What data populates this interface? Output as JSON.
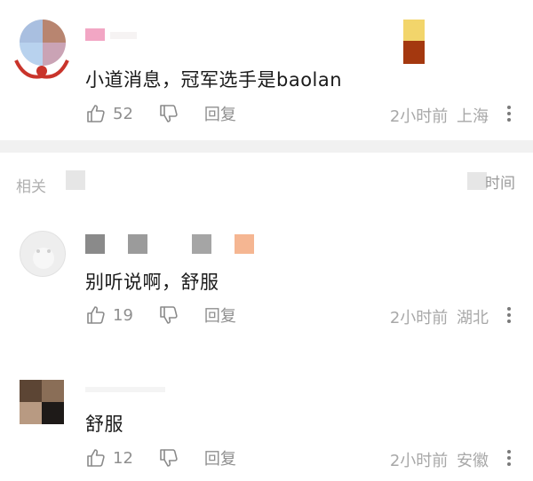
{
  "comments": [
    {
      "content": "小道消息，冠军选手是baolan",
      "likes": "52",
      "reply_label": "回复",
      "time": "2小时前",
      "location": "上海"
    },
    {
      "content": "别听说啊，舒服",
      "likes": "19",
      "reply_label": "回复",
      "time": "2小时前",
      "location": "湖北"
    },
    {
      "content": "舒服",
      "likes": "12",
      "reply_label": "回复",
      "time": "2小时前",
      "location": "安徽"
    }
  ],
  "section": {
    "left_label": "相关",
    "sort_label": "时间"
  },
  "icons": [
    "thumb-up-icon",
    "thumb-down-icon",
    "more-vertical-icon"
  ],
  "colors": {
    "meta_text": "#a8a8a8",
    "action_text": "#8f8f8f",
    "separator": "#f1f1f1"
  }
}
